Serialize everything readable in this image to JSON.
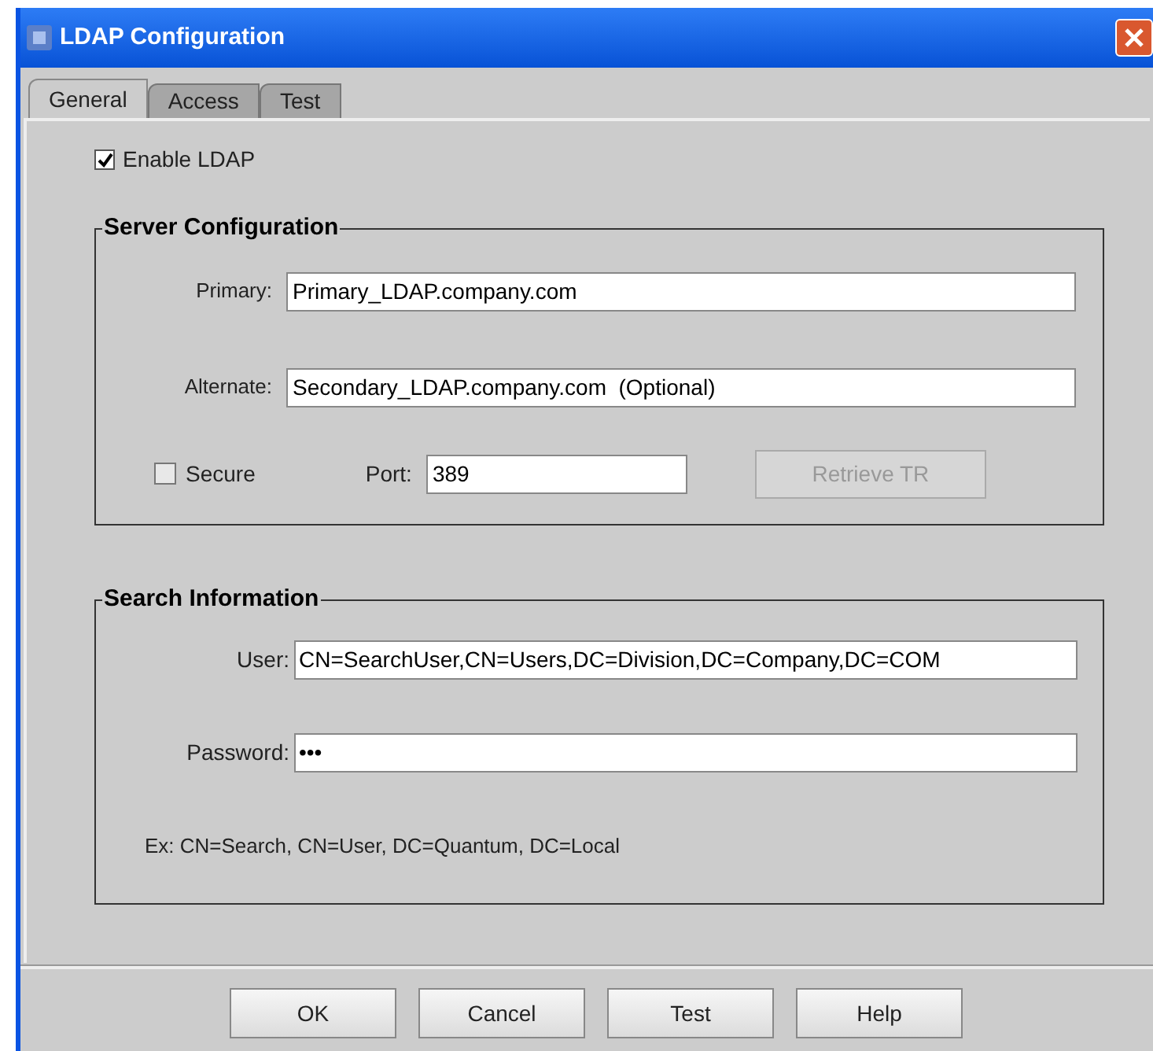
{
  "window": {
    "title": "LDAP Configuration"
  },
  "tabs": [
    {
      "label": "General",
      "selected": true
    },
    {
      "label": "Access",
      "selected": false
    },
    {
      "label": "Test",
      "selected": false
    }
  ],
  "enable_ldap": {
    "label": "Enable LDAP",
    "checked": true
  },
  "server_configuration": {
    "title": "Server Configuration",
    "primary": {
      "label": "Primary:",
      "value": "Primary_LDAP.company.com"
    },
    "alternate": {
      "label": "Alternate:",
      "value": "Secondary_LDAP.company.com  (Optional)"
    },
    "secure": {
      "label": "Secure",
      "checked": false
    },
    "port": {
      "label": "Port:",
      "value": "389"
    },
    "retrieve_button": {
      "label": "Retrieve TR",
      "disabled": true
    }
  },
  "search_information": {
    "title": "Search Information",
    "user": {
      "label": "User:",
      "value": "CN=SearchUser,CN=Users,DC=Division,DC=Company,DC=COM"
    },
    "password": {
      "label": "Password:",
      "value": "•••"
    },
    "example": "Ex: CN=Search, CN=User, DC=Quantum, DC=Local"
  },
  "buttons": [
    "OK",
    "Cancel",
    "Test",
    "Help"
  ]
}
